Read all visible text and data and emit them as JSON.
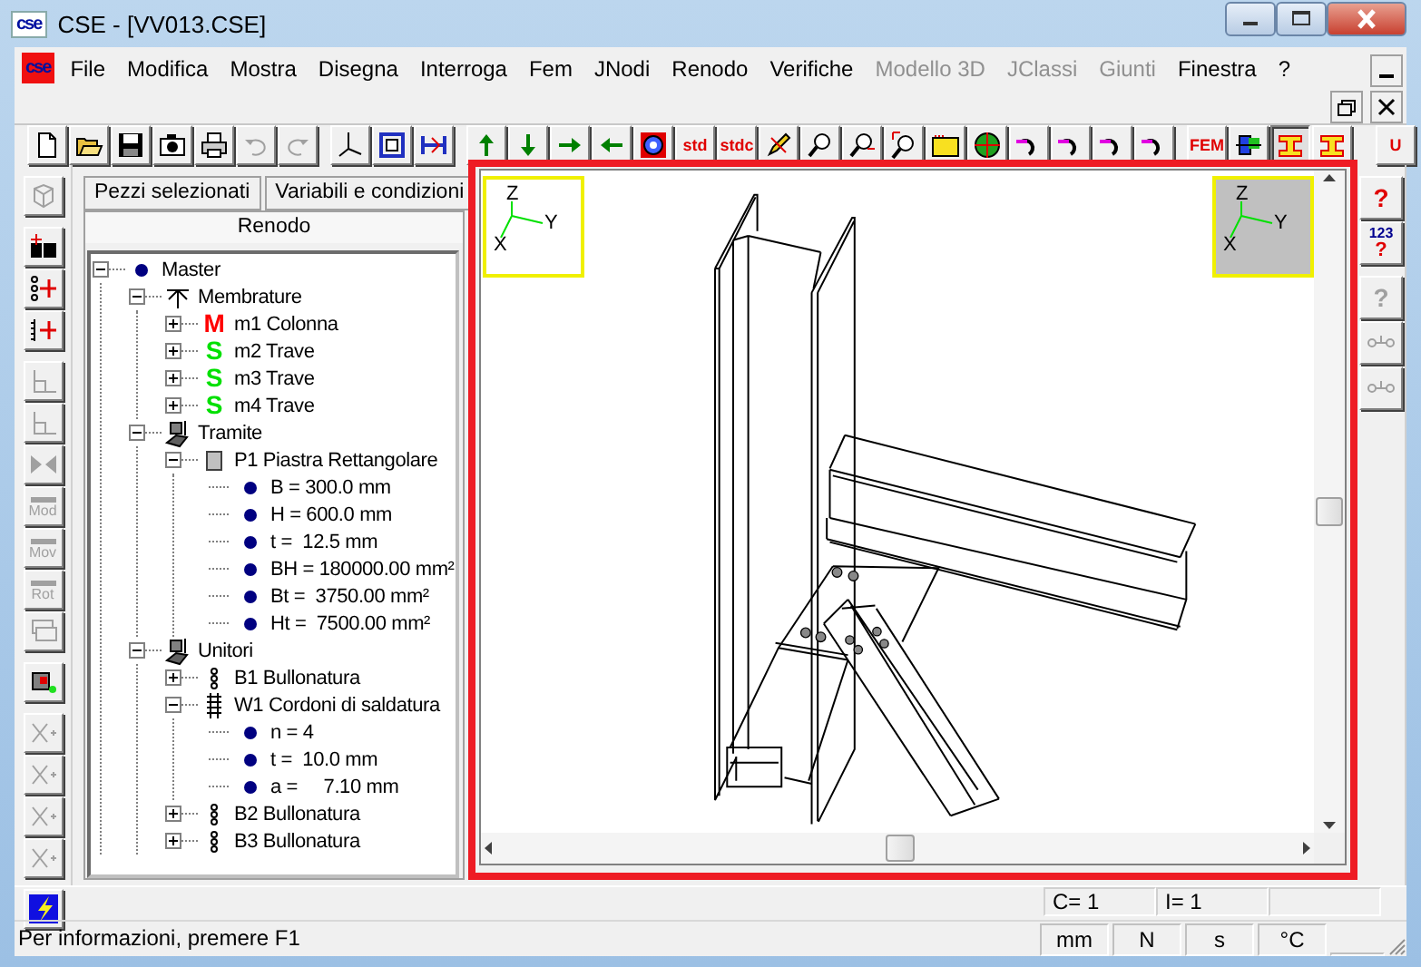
{
  "window": {
    "title": "CSE - [VV013.CSE]",
    "logo": "cse"
  },
  "menu": {
    "logo": "cse",
    "items": [
      {
        "label": "File",
        "disabled": false
      },
      {
        "label": "Modifica",
        "disabled": false
      },
      {
        "label": "Mostra",
        "disabled": false
      },
      {
        "label": "Disegna",
        "disabled": false
      },
      {
        "label": "Interroga",
        "disabled": false
      },
      {
        "label": "Fem",
        "disabled": false
      },
      {
        "label": "JNodi",
        "disabled": false
      },
      {
        "label": "Renodo",
        "disabled": false
      },
      {
        "label": "Verifiche",
        "disabled": false
      },
      {
        "label": "Modello 3D",
        "disabled": true
      },
      {
        "label": "JClassi",
        "disabled": true
      },
      {
        "label": "Giunti",
        "disabled": true
      },
      {
        "label": "Finestra",
        "disabled": false
      },
      {
        "label": "?",
        "disabled": false
      }
    ]
  },
  "toolbar": [
    [
      {
        "kind": "new",
        "disabled": false,
        "pressed": false
      },
      {
        "kind": "open",
        "disabled": false,
        "pressed": false
      },
      {
        "kind": "save",
        "disabled": false,
        "pressed": false
      },
      {
        "kind": "camera",
        "disabled": false,
        "pressed": false
      },
      {
        "kind": "print",
        "disabled": false,
        "pressed": false
      },
      {
        "kind": "undo",
        "disabled": true,
        "pressed": false
      },
      {
        "kind": "redo",
        "disabled": true,
        "pressed": false
      }
    ],
    [
      {
        "kind": "axes",
        "disabled": false,
        "pressed": false
      },
      {
        "kind": "frame",
        "disabled": false,
        "pressed": false
      },
      {
        "kind": "dimension",
        "disabled": false,
        "pressed": false
      }
    ],
    [
      {
        "kind": "arrow-up",
        "disabled": false,
        "pressed": false
      },
      {
        "kind": "arrow-down",
        "disabled": false,
        "pressed": false
      },
      {
        "kind": "arrow-right",
        "disabled": false,
        "pressed": false
      },
      {
        "kind": "arrow-left",
        "disabled": false,
        "pressed": false
      },
      {
        "kind": "target",
        "disabled": false,
        "pressed": false
      },
      {
        "kind": "text",
        "label": "std",
        "disabled": false,
        "pressed": false
      },
      {
        "kind": "text",
        "label": "stdc",
        "disabled": false,
        "pressed": false
      },
      {
        "kind": "pencil",
        "disabled": false,
        "pressed": false
      },
      {
        "kind": "zoom",
        "disabled": false,
        "pressed": false
      },
      {
        "kind": "zoom-out",
        "disabled": false,
        "pressed": false
      },
      {
        "kind": "zoom-window",
        "disabled": false,
        "pressed": false
      },
      {
        "kind": "folder",
        "disabled": false,
        "pressed": false
      },
      {
        "kind": "globe",
        "disabled": false,
        "pressed": false
      },
      {
        "kind": "rotate",
        "disabled": false,
        "pressed": false
      },
      {
        "kind": "rotate",
        "disabled": false,
        "pressed": false
      },
      {
        "kind": "rotate",
        "disabled": false,
        "pressed": false
      },
      {
        "kind": "rotate",
        "disabled": false,
        "pressed": false
      }
    ],
    [
      {
        "kind": "text",
        "label": "FEM",
        "disabled": false,
        "pressed": false
      },
      {
        "kind": "color",
        "disabled": false,
        "pressed": false
      },
      {
        "kind": "section",
        "disabled": false,
        "pressed": true
      },
      {
        "kind": "section",
        "disabled": false,
        "pressed": false
      }
    ],
    [
      {
        "kind": "text",
        "label": "U",
        "disabled": false,
        "pressed": false
      }
    ]
  ],
  "side_toolbar": [
    [
      {
        "kind": "cube",
        "disabled": true
      }
    ],
    [
      {
        "kind": "add-block",
        "disabled": false
      },
      {
        "kind": "add-node",
        "disabled": false
      },
      {
        "kind": "add-bar",
        "disabled": false
      }
    ],
    [
      {
        "kind": "tool",
        "disabled": true
      },
      {
        "kind": "tool",
        "disabled": true
      },
      {
        "kind": "mirror",
        "disabled": true
      },
      {
        "kind": "bar",
        "label": "Mod",
        "disabled": true
      },
      {
        "kind": "bar",
        "label": "Mov",
        "disabled": true
      },
      {
        "kind": "bar",
        "label": "Rot",
        "disabled": true
      },
      {
        "kind": "layers",
        "disabled": true
      }
    ],
    [
      {
        "kind": "query",
        "disabled": false
      }
    ],
    [
      {
        "kind": "cross",
        "disabled": true
      },
      {
        "kind": "cross",
        "disabled": true
      },
      {
        "kind": "cross",
        "disabled": true
      },
      {
        "kind": "cross",
        "disabled": true
      }
    ],
    [
      {
        "kind": "lightning",
        "disabled": false
      }
    ]
  ],
  "tabs": [
    {
      "label": "Pezzi selezionati",
      "selected": false
    },
    {
      "label": "Variabili e condizioni",
      "selected": false
    },
    {
      "label": "Renodo",
      "selected": true
    }
  ],
  "tree": [
    {
      "label": "Master",
      "kind": "dot",
      "expanded": true,
      "children": [
        {
          "label": "Membrature",
          "kind": "members",
          "expanded": true,
          "children": [
            {
              "label": "m1 Colonna",
              "kind": "member",
              "badge": "M",
              "color": "#ff0000",
              "expanded": false
            },
            {
              "label": "m2 Trave",
              "kind": "member",
              "badge": "S",
              "color": "#00e000",
              "expanded": false
            },
            {
              "label": "m3 Trave",
              "kind": "member",
              "badge": "S",
              "color": "#00e000",
              "expanded": false
            },
            {
              "label": "m4 Trave",
              "kind": "member",
              "badge": "S",
              "color": "#00e000",
              "expanded": false
            }
          ]
        },
        {
          "label": "Tramite",
          "kind": "connector",
          "expanded": true,
          "children": [
            {
              "label": "P1 Piastra Rettangolare",
              "kind": "plate",
              "expanded": true,
              "children": [
                {
                  "label": "B = 300.0 mm",
                  "kind": "dot"
                },
                {
                  "label": "H = 600.0 mm",
                  "kind": "dot"
                },
                {
                  "label": "t =  12.5 mm",
                  "kind": "dot"
                },
                {
                  "label": "BH = 180000.00 mm²",
                  "kind": "dot"
                },
                {
                  "label": "Bt =  3750.00 mm²",
                  "kind": "dot"
                },
                {
                  "label": "Ht =  7500.00 mm²",
                  "kind": "dot"
                }
              ]
            }
          ]
        },
        {
          "label": "Unitori",
          "kind": "connector",
          "expanded": true,
          "children": [
            {
              "label": "B1 Bullonatura",
              "kind": "bolts",
              "expanded": false
            },
            {
              "label": "W1 Cordoni di saldatura",
              "kind": "weld",
              "expanded": true,
              "children": [
                {
                  "label": "n = 4",
                  "kind": "dot"
                },
                {
                  "label": "t =  10.0 mm",
                  "kind": "dot"
                },
                {
                  "label": "a =     7.10 mm",
                  "kind": "dot"
                }
              ]
            },
            {
              "label": "B2 Bullonatura",
              "kind": "bolts",
              "expanded": false
            },
            {
              "label": "B3 Bullonatura",
              "kind": "bolts",
              "expanded": false
            }
          ]
        }
      ]
    }
  ],
  "view": {
    "axes": [
      {
        "z": "Z",
        "y": "Y",
        "x": "X",
        "active": false
      },
      {
        "z": "Z",
        "y": "Y",
        "x": "X",
        "active": true
      }
    ]
  },
  "right_toolbar": [
    [
      {
        "kind": "help",
        "label": "?",
        "disabled": false
      },
      {
        "kind": "help-number",
        "label": "123",
        "sub": "?",
        "disabled": false
      }
    ],
    [
      {
        "kind": "help",
        "label": "?",
        "disabled": true
      },
      {
        "kind": "link",
        "disabled": true
      },
      {
        "kind": "link",
        "disabled": true
      }
    ]
  ],
  "counters": [
    "C= 1",
    "I= 1"
  ],
  "status_bar": {
    "message": "Per informazioni, premere F1",
    "units": [
      "mm",
      "N",
      "s",
      "°C"
    ]
  }
}
